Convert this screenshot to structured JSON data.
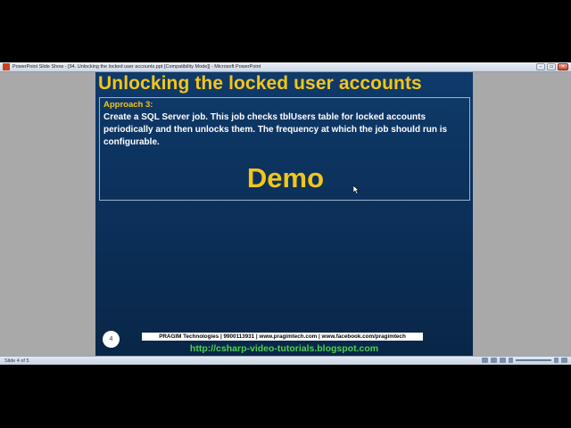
{
  "window": {
    "title": "PowerPoint Slide Show - [94. Unlocking the locked user accounts.ppt [Compatibility Mode]] - Microsoft PowerPoint"
  },
  "slide": {
    "title": "Unlocking the locked user accounts",
    "approach_label": "Approach 3:",
    "body": "Create a SQL Server job. This job checks tblUsers table for locked accounts periodically and then unlocks them. The frequency at which the job should run is configurable.",
    "demo": "Demo",
    "number": "4",
    "footer": "PRAGIM Technologies | 9900113931 | www.pragimtech.com | www.facebook.com/pragimtech",
    "link": "http://csharp-video-tutorials.blogspot.com"
  },
  "statusbar": {
    "slide_indicator": "Slide 4 of 5"
  },
  "colors": {
    "slide_bg": "#0b2f58",
    "accent_gold": "#f5c518",
    "link_green": "#4ed24e"
  }
}
